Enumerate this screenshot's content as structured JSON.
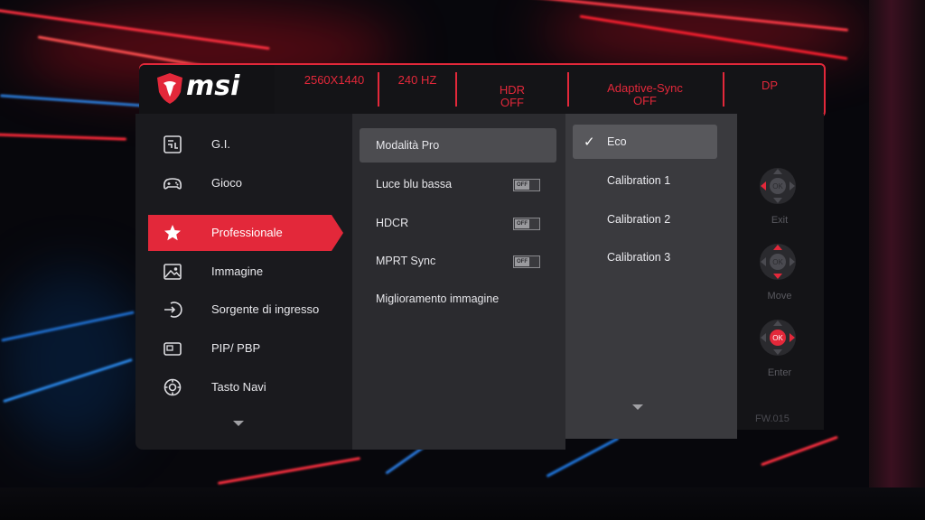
{
  "header": {
    "brand": "msi",
    "stats": [
      {
        "line1": "2560X1440",
        "line2": ""
      },
      {
        "line1": "240 HZ",
        "line2": ""
      },
      {
        "line1": "HDR",
        "line2": "OFF"
      },
      {
        "line1": "Adaptive-Sync",
        "line2": "OFF"
      },
      {
        "line1": "DP",
        "line2": ""
      }
    ]
  },
  "sidebar": {
    "items": [
      {
        "label": "G.I.",
        "icon": "gaming-intelligence-icon"
      },
      {
        "label": "Gioco",
        "icon": "gamepad-icon"
      },
      {
        "label": "Professionale",
        "icon": "star-icon",
        "active": true
      },
      {
        "label": "Immagine",
        "icon": "image-icon"
      },
      {
        "label": "Sorgente di ingresso",
        "icon": "input-source-icon"
      },
      {
        "label": "PIP/ PBP",
        "icon": "pip-icon"
      },
      {
        "label": "Tasto Navi",
        "icon": "navi-key-icon"
      }
    ]
  },
  "middle": {
    "items": [
      {
        "label": "Modalità Pro",
        "selected": true
      },
      {
        "label": "Luce blu bassa",
        "toggle": "OFF"
      },
      {
        "label": "HDCR",
        "toggle": "OFF"
      },
      {
        "label": "MPRT Sync",
        "toggle": "OFF"
      },
      {
        "label": "Miglioramento immagine"
      }
    ]
  },
  "submenu": {
    "items": [
      {
        "label": "Eco",
        "checked": true
      },
      {
        "label": "Calibration 1"
      },
      {
        "label": "Calibration 2"
      },
      {
        "label": "Calibration 3"
      }
    ]
  },
  "navigation": {
    "buttons": [
      {
        "label": "Exit",
        "icon": "dpad-exit-icon"
      },
      {
        "label": "Move",
        "icon": "dpad-move-icon"
      },
      {
        "label": "Enter",
        "icon": "dpad-enter-icon"
      }
    ],
    "ok_text": "OK",
    "firmware": "FW.015"
  },
  "colors": {
    "accent": "#e3283a",
    "panel_dark": "#1a1a1e",
    "panel_mid": "#2b2b2f",
    "panel_light": "#3a3a3e"
  }
}
